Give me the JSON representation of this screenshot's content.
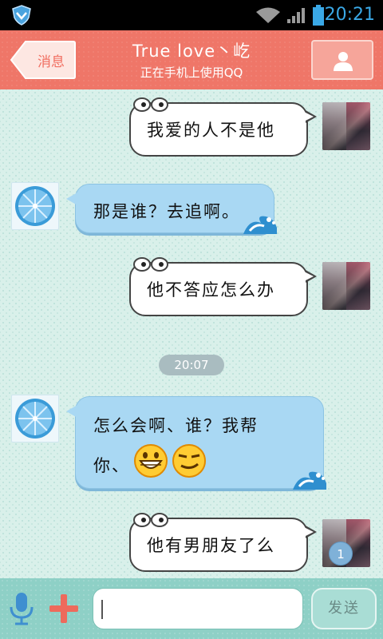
{
  "status_bar": {
    "time": "20:21",
    "icons": [
      "shield-icon",
      "wifi-icon",
      "signal-icon",
      "battery-icon"
    ],
    "time_color": "#3aa8e6"
  },
  "header": {
    "back_label": "消息",
    "contact_name": "True love丶屹",
    "contact_status": "正在手机上使用QQ",
    "profile_icon": "person-icon",
    "color": "#ef7668"
  },
  "messages": [
    {
      "from": "me",
      "text": "我爱的人不是他"
    },
    {
      "from": "other",
      "text": "那是谁？去追啊。"
    },
    {
      "from": "me",
      "text": "他不答应怎么办"
    },
    {
      "from": "timestamp",
      "text": "20:07"
    },
    {
      "from": "other",
      "text_line1": "怎么会啊、谁？我帮",
      "text_line2": "你、",
      "emojis": [
        "grin-emoji",
        "smirk-emoji"
      ]
    },
    {
      "from": "me",
      "text": "他有男朋友了么"
    }
  ],
  "unread_count": "1",
  "input_bar": {
    "voice_icon": "microphone-icon",
    "more_icon": "plus-icon",
    "message_value": "",
    "send_label": "发送"
  }
}
